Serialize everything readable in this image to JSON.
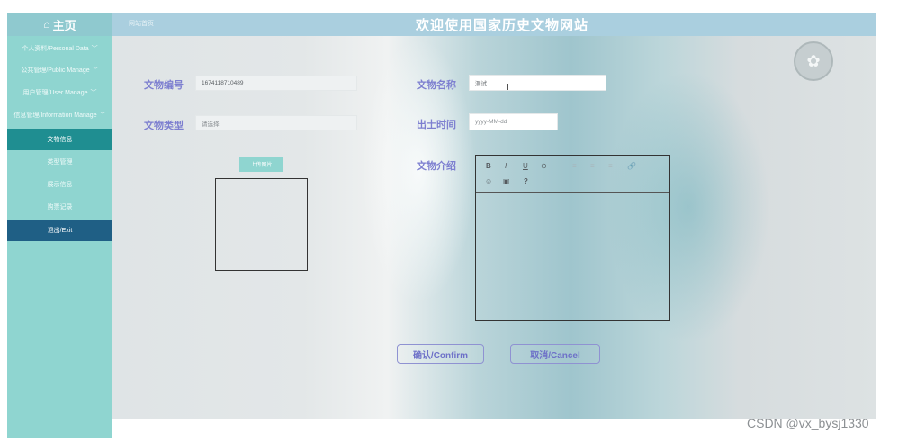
{
  "header": {
    "home_label": "主页",
    "home_icon": "home-icon",
    "breadcrumb": "网站首页",
    "title": "欢迎使用国家历史文物网站"
  },
  "sidebar": {
    "items": [
      {
        "label": "个人资料/Personal Data",
        "chevron": "﹀"
      },
      {
        "label": "公共管理/Public Manage",
        "chevron": "﹀"
      },
      {
        "label": "用户管理/User Manage",
        "chevron": "﹀"
      },
      {
        "label": "信息管理/Information Manage",
        "chevron": "﹀"
      },
      {
        "label": "文物信息"
      },
      {
        "label": "类型管理"
      },
      {
        "label": "展示信息"
      },
      {
        "label": "购票记录"
      },
      {
        "label": "退出/Exit"
      }
    ]
  },
  "form": {
    "id_label": "文物编号",
    "id_value": "1674118710489",
    "name_label": "文物名称",
    "name_value": "测试",
    "type_label": "文物类型",
    "type_placeholder": "请选择",
    "date_label": "出土时间",
    "date_placeholder": "yyyy-MM-dd",
    "intro_label": "文物介绍",
    "upload_label": "上传图片",
    "cursor": "I"
  },
  "editor_toolbar": [
    "B",
    "I",
    "U",
    "⊖",
    "≡",
    "≡",
    "≡",
    "🔗",
    "☺",
    "▣",
    "?"
  ],
  "buttons": {
    "confirm": "确认/Confirm",
    "cancel": "取消/Cancel"
  },
  "watermark": "CSDN @vx_bysj1330",
  "colors": {
    "sidebar": "#8fd5d0",
    "active": "#1f8e91",
    "exit": "#1f5f85",
    "header": "#aacfdf",
    "label": "#7d7fd0"
  }
}
